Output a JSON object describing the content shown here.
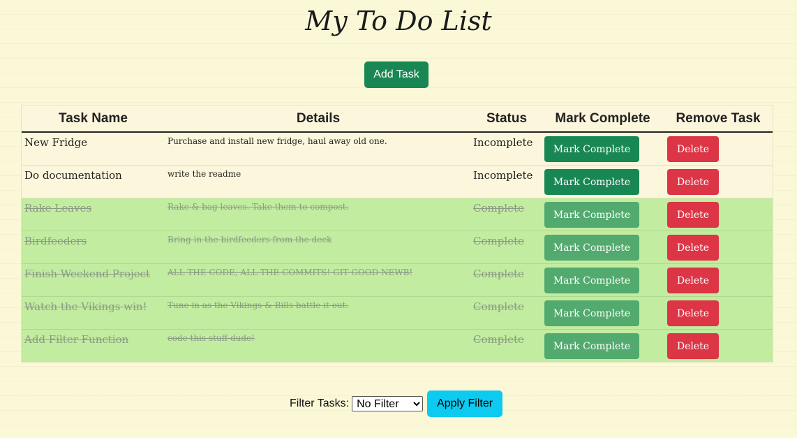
{
  "header": {
    "title": "My To Do List",
    "add_task_label": "Add Task"
  },
  "table": {
    "columns": [
      "Task Name",
      "Details",
      "Status",
      "Mark Complete",
      "Remove Task"
    ],
    "rows": [
      {
        "name": "New Fridge",
        "details": "Purchase and install new fridge, haul away old one.",
        "status": "Incomplete",
        "mark_label": "Mark Complete",
        "delete_label": "Delete",
        "completed": false
      },
      {
        "name": "Do documentation",
        "details": "write the readme",
        "status": "Incomplete",
        "mark_label": "Mark Complete",
        "delete_label": "Delete",
        "completed": false
      },
      {
        "name": "Rake Leaves",
        "details": "Rake & bag leaves. Take them to compost.",
        "status": "Complete",
        "mark_label": "Mark Complete",
        "delete_label": "Delete",
        "completed": true
      },
      {
        "name": "Birdfeeders",
        "details": "Bring in the birdfeeders from the deck",
        "status": "Complete",
        "mark_label": "Mark Complete",
        "delete_label": "Delete",
        "completed": true
      },
      {
        "name": "Finish Weekend Project",
        "details": "ALL THE CODE, ALL THE COMMITS! GIT GOOD NEWB!",
        "status": "Complete",
        "mark_label": "Mark Complete",
        "delete_label": "Delete",
        "completed": true
      },
      {
        "name": "Watch the Vikings win!",
        "details": "Tune in as the Vikings & Bills battle it out.",
        "status": "Complete",
        "mark_label": "Mark Complete",
        "delete_label": "Delete",
        "completed": true
      },
      {
        "name": "Add Filter Function",
        "details": "code this stuff dude!",
        "status": "Complete",
        "mark_label": "Mark Complete",
        "delete_label": "Delete",
        "completed": true
      }
    ]
  },
  "filter": {
    "label": "Filter Tasks:",
    "selected": "No Filter",
    "apply_label": "Apply Filter"
  },
  "colors": {
    "background": "#fbf8d8",
    "success": "#198754",
    "success_faded": "#52aa6e",
    "danger": "#dc3545",
    "info": "#0dcaf0",
    "completed_row": "#c2ec9f"
  }
}
